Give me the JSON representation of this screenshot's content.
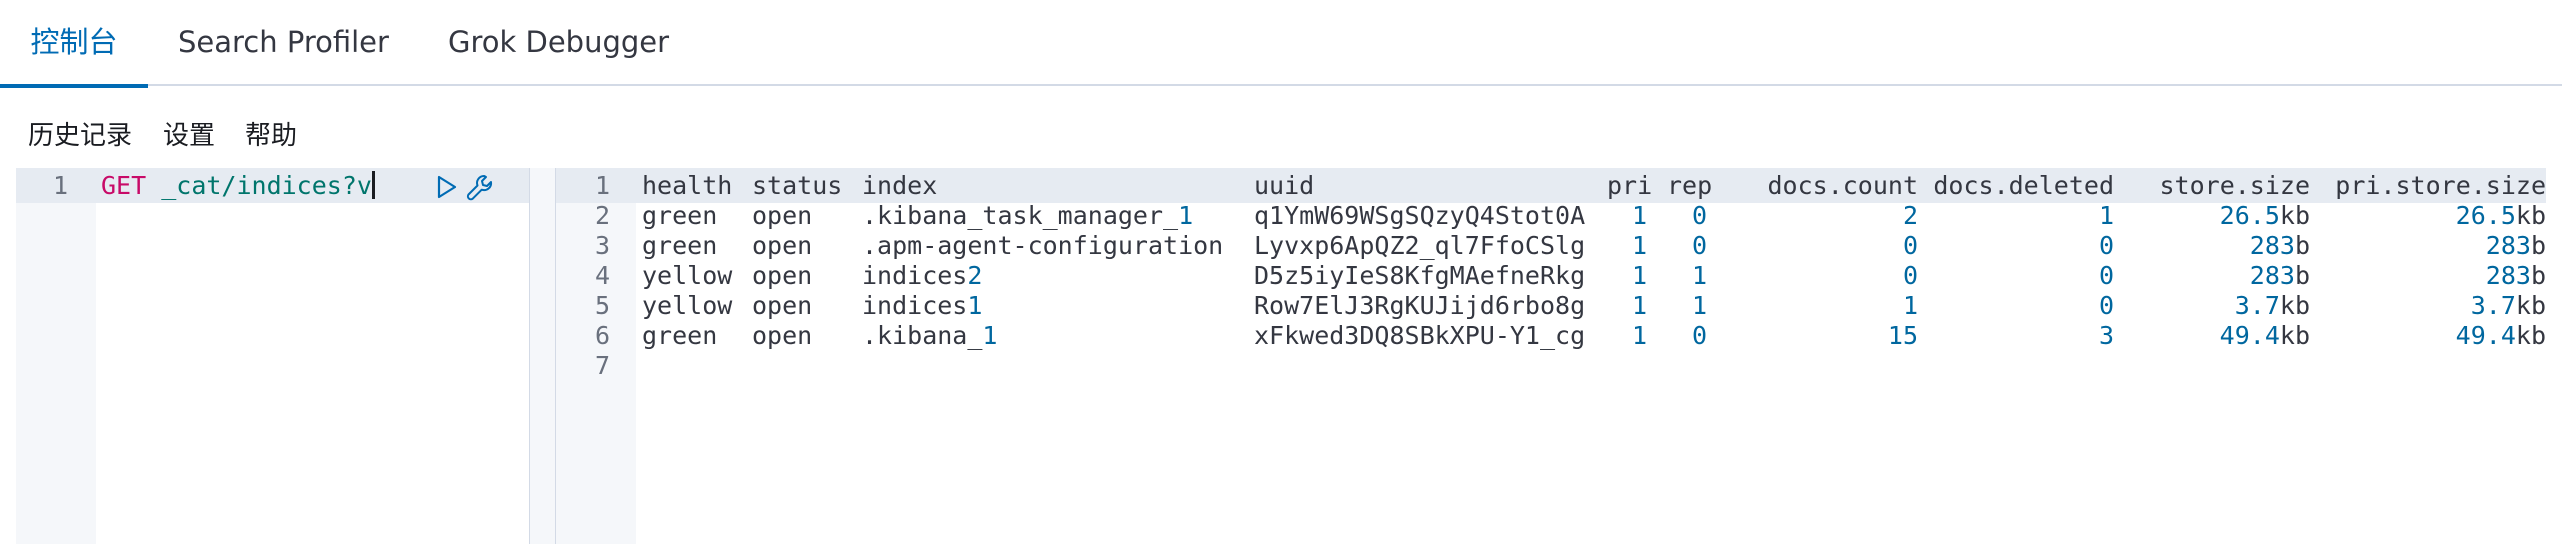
{
  "tabs": [
    {
      "label": "控制台",
      "active": true
    },
    {
      "label": "Search Profiler",
      "active": false
    },
    {
      "label": "Grok Debugger",
      "active": false
    }
  ],
  "toolbar": {
    "history": "历史记录",
    "settings": "设置",
    "help": "帮助"
  },
  "editor": {
    "line_number": "1",
    "method": "GET",
    "path": "_cat/indices?v",
    "run_icon": "play-icon",
    "wrench_icon": "wrench-icon"
  },
  "output": {
    "line_numbers": [
      "1",
      "2",
      "3",
      "4",
      "5",
      "6",
      "7"
    ],
    "header": {
      "health": "health",
      "status": "status",
      "index": "index",
      "uuid": "uuid",
      "pri": "pri",
      "rep": "rep",
      "docs_count": "docs.count",
      "docs_deleted": "docs.deleted",
      "store_size": "store.size",
      "pri_store_size": "pri.store.size"
    },
    "rows": [
      {
        "health": "green",
        "status": "open",
        "index_text": ".kibana_task_manager_",
        "index_num": "1",
        "uuid": "q1YmW69WSgSQzyQ4Stot0A",
        "pri": "1",
        "rep": "0",
        "docs_count": "2",
        "docs_deleted": "1",
        "store_num": "26.5",
        "store_unit": "kb",
        "pstore_num": "26.5",
        "pstore_unit": "kb"
      },
      {
        "health": "green",
        "status": "open",
        "index_text": ".apm-agent-configuration",
        "index_num": "",
        "uuid": "Lyvxp6ApQZ2_ql7FfoCSlg",
        "pri": "1",
        "rep": "0",
        "docs_count": "0",
        "docs_deleted": "0",
        "store_num": "283",
        "store_unit": "b",
        "pstore_num": "283",
        "pstore_unit": "b"
      },
      {
        "health": "yellow",
        "status": "open",
        "index_text": "indices",
        "index_num": "2",
        "uuid": "D5z5iyIeS8KfgMAefneRkg",
        "pri": "1",
        "rep": "1",
        "docs_count": "0",
        "docs_deleted": "0",
        "store_num": "283",
        "store_unit": "b",
        "pstore_num": "283",
        "pstore_unit": "b"
      },
      {
        "health": "yellow",
        "status": "open",
        "index_text": "indices",
        "index_num": "1",
        "uuid": "Row7ElJ3RgKUJijd6rbo8g",
        "pri": "1",
        "rep": "1",
        "docs_count": "1",
        "docs_deleted": "0",
        "store_num": "3.7",
        "store_unit": "kb",
        "pstore_num": "3.7",
        "pstore_unit": "kb"
      },
      {
        "health": "green",
        "status": "open",
        "index_text": ".kibana_",
        "index_num": "1",
        "uuid": "xFkwed3DQ8SBkXPU-Y1_cg",
        "pri": "1",
        "rep": "0",
        "docs_count": "15",
        "docs_deleted": "3",
        "store_num": "49.4",
        "store_unit": "kb",
        "pstore_num": "49.4",
        "pstore_unit": "kb"
      }
    ]
  },
  "colors": {
    "accent": "#006bb4",
    "method": "#c80a68",
    "url": "#00756c",
    "number": "#00679f",
    "gutter": "#f5f7fa",
    "active_line": "#e6ebf2"
  }
}
